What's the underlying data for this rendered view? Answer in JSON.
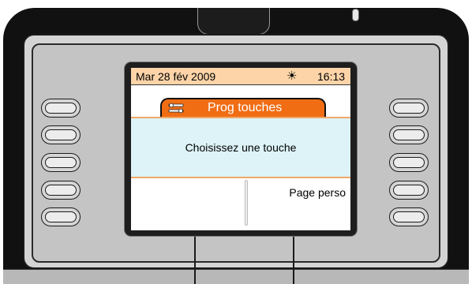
{
  "status_bar": {
    "date": "Mar 28 fév 2009",
    "weather_icon": "sun-icon",
    "time": "16:13"
  },
  "header": {
    "icon": "wrench-keys-icon",
    "title": "Prog touches"
  },
  "dialog": {
    "message": "Choisissez une touche"
  },
  "softkeys": {
    "right": [
      "",
      "",
      "",
      "Page perso",
      ""
    ],
    "left": [
      "",
      "",
      "",
      "",
      ""
    ]
  },
  "colors": {
    "status_bar_bg": "#fcd4a8",
    "title_tab_bg": "#f06d14",
    "dialog_bg": "#ddf3f8",
    "dialog_border": "#f0a868"
  }
}
